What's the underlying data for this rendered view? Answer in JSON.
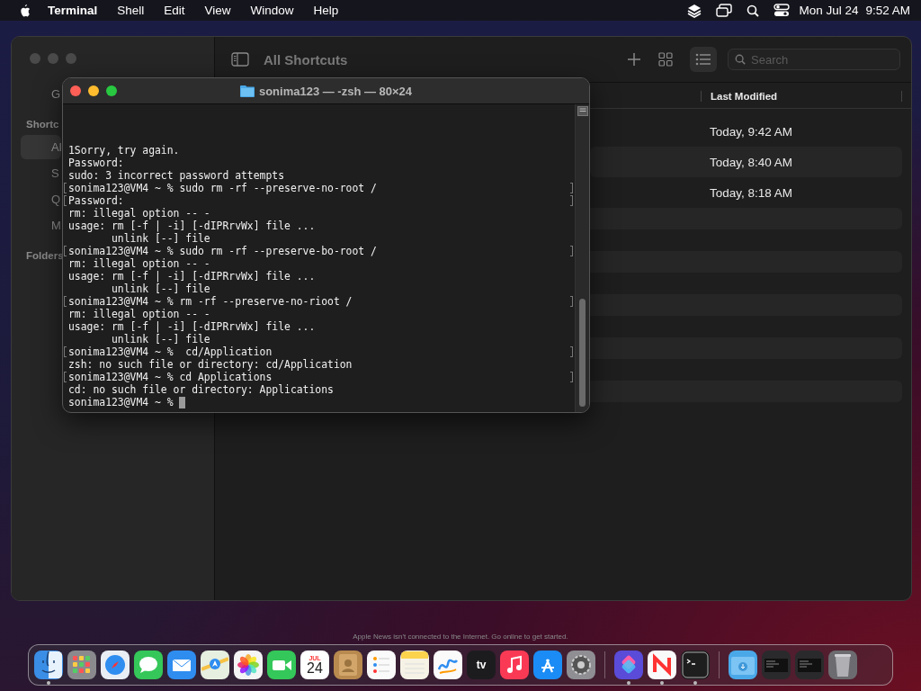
{
  "menu_bar": {
    "app": "Terminal",
    "menus": [
      "Shell",
      "Edit",
      "View",
      "Window",
      "Help"
    ],
    "date": "Mon Jul 24",
    "time": "9:52 AM"
  },
  "shortcuts_window": {
    "title": "All Shortcuts",
    "search": {
      "placeholder": "Search"
    },
    "view_modes": [
      {
        "kind": "grid",
        "selected": false
      },
      {
        "kind": "list",
        "selected": true
      }
    ],
    "sidebar": [
      {
        "kind": "item",
        "label": "G",
        "selected": false
      },
      {
        "kind": "heading",
        "label": "Shortc"
      },
      {
        "kind": "item",
        "label": "Al",
        "selected": true
      },
      {
        "kind": "item",
        "label": "S",
        "selected": false
      },
      {
        "kind": "item",
        "label": "Q",
        "selected": false
      },
      {
        "kind": "item",
        "label": "M",
        "selected": false
      },
      {
        "kind": "heading",
        "label": "Folders"
      }
    ],
    "table": {
      "columns": [
        "Last Modified"
      ],
      "rows": [
        {
          "last_modified": "Today, 9:42 AM"
        },
        {
          "last_modified": "Today, 8:40 AM"
        },
        {
          "last_modified": "Today, 8:18 AM"
        }
      ]
    }
  },
  "terminal": {
    "title": "sonima123 — -zsh — 80×24",
    "lines": [
      {
        "text": "1Sorry, try again.",
        "marked": false
      },
      {
        "text": "Password:",
        "marked": false
      },
      {
        "text": "sudo: 3 incorrect password attempts",
        "marked": false
      },
      {
        "text": "sonima123@VM4 ~ % sudo rm -rf --preserve-no-root /",
        "marked": true
      },
      {
        "text": "Password:",
        "marked": true
      },
      {
        "text": "rm: illegal option -- -",
        "marked": false
      },
      {
        "text": "usage: rm [-f | -i] [-dIPRrvWx] file ...",
        "marked": false
      },
      {
        "text": "       unlink [--] file",
        "marked": false
      },
      {
        "text": "sonima123@VM4 ~ % sudo rm -rf --preserve-bo-root /",
        "marked": true
      },
      {
        "text": "rm: illegal option -- -",
        "marked": false
      },
      {
        "text": "usage: rm [-f | -i] [-dIPRrvWx] file ...",
        "marked": false
      },
      {
        "text": "       unlink [--] file",
        "marked": false
      },
      {
        "text": "sonima123@VM4 ~ % rm -rf --preserve-no-rioot /",
        "marked": true
      },
      {
        "text": "rm: illegal option -- -",
        "marked": false
      },
      {
        "text": "usage: rm [-f | -i] [-dIPRrvWx] file ...",
        "marked": false
      },
      {
        "text": "       unlink [--] file",
        "marked": false
      },
      {
        "text": "sonima123@VM4 ~ %  cd/Application",
        "marked": true
      },
      {
        "text": "zsh: no such file or directory: cd/Application",
        "marked": false
      },
      {
        "text": "sonima123@VM4 ~ % cd Applications",
        "marked": true
      },
      {
        "text": "cd: no such file or directory: Applications",
        "marked": false
      },
      {
        "text": "sonima123@VM4 ~ % ",
        "marked": false,
        "cursor": true
      }
    ]
  },
  "notice": "Apple News isn't connected to the Internet. Go online to get started.",
  "dock": {
    "items": [
      {
        "kind": "finder",
        "running": true
      },
      {
        "kind": "launchpad",
        "running": false
      },
      {
        "kind": "safari",
        "running": false
      },
      {
        "kind": "messages",
        "running": false
      },
      {
        "kind": "mail",
        "running": false
      },
      {
        "kind": "maps",
        "running": false
      },
      {
        "kind": "photos",
        "running": false
      },
      {
        "kind": "facetime",
        "running": false
      },
      {
        "kind": "calendar",
        "month": "JUL",
        "day": "24",
        "running": false
      },
      {
        "kind": "contacts",
        "running": false
      },
      {
        "kind": "reminders",
        "running": false
      },
      {
        "kind": "notes",
        "running": false
      },
      {
        "kind": "freeform",
        "running": false
      },
      {
        "kind": "tv",
        "label": "tv",
        "running": false
      },
      {
        "kind": "music",
        "running": false
      },
      {
        "kind": "appstore",
        "running": false
      },
      {
        "kind": "settings",
        "running": false
      },
      {
        "kind": "separator"
      },
      {
        "kind": "shortcuts",
        "running": true
      },
      {
        "kind": "news",
        "running": true
      },
      {
        "kind": "terminal",
        "running": true
      },
      {
        "kind": "separator"
      },
      {
        "kind": "folder",
        "running": false
      },
      {
        "kind": "window_preview",
        "running": false
      },
      {
        "kind": "window_preview",
        "running": false
      },
      {
        "kind": "trash",
        "running": false
      }
    ]
  }
}
